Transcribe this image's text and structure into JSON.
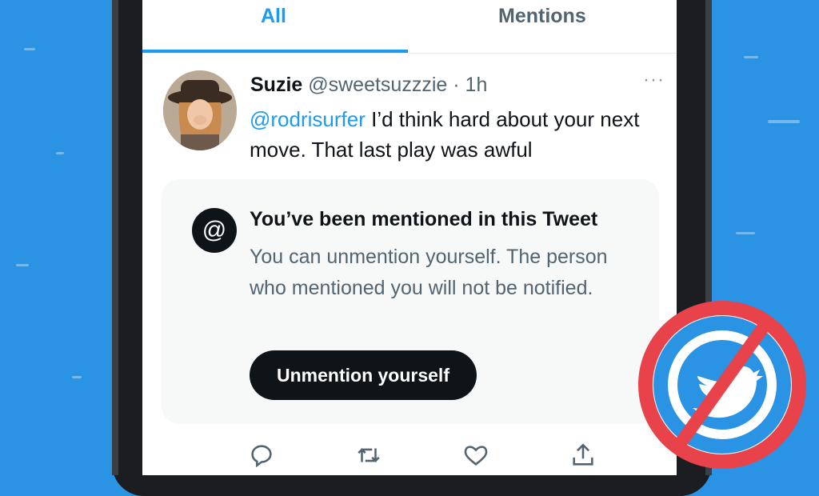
{
  "tabs": [
    {
      "label": "All",
      "active": true
    },
    {
      "label": "Mentions",
      "active": false
    }
  ],
  "tweet": {
    "author_name": "Suzie",
    "author_handle": "@sweetsuzzzie",
    "separator": "·",
    "time": "1h",
    "mention": "@rodrisurfer",
    "text": " I’d think hard about your next move. That last play was awful",
    "more_icon": "more-icon"
  },
  "notice": {
    "icon": "at-icon",
    "icon_glyph": "@",
    "title": "You’ve been mentioned in this Tweet",
    "text": "You can unmention yourself. The person who mentioned you will not be notified.",
    "button_label": "Unmention yourself"
  },
  "actions": [
    "reply-icon",
    "retweet-icon",
    "like-icon",
    "share-icon"
  ],
  "colors": {
    "background": "#2a93e3",
    "accent": "#1d9bf0",
    "text": "#0f1419",
    "secondary_text": "#536471",
    "badge_ring": "#e8434a"
  }
}
